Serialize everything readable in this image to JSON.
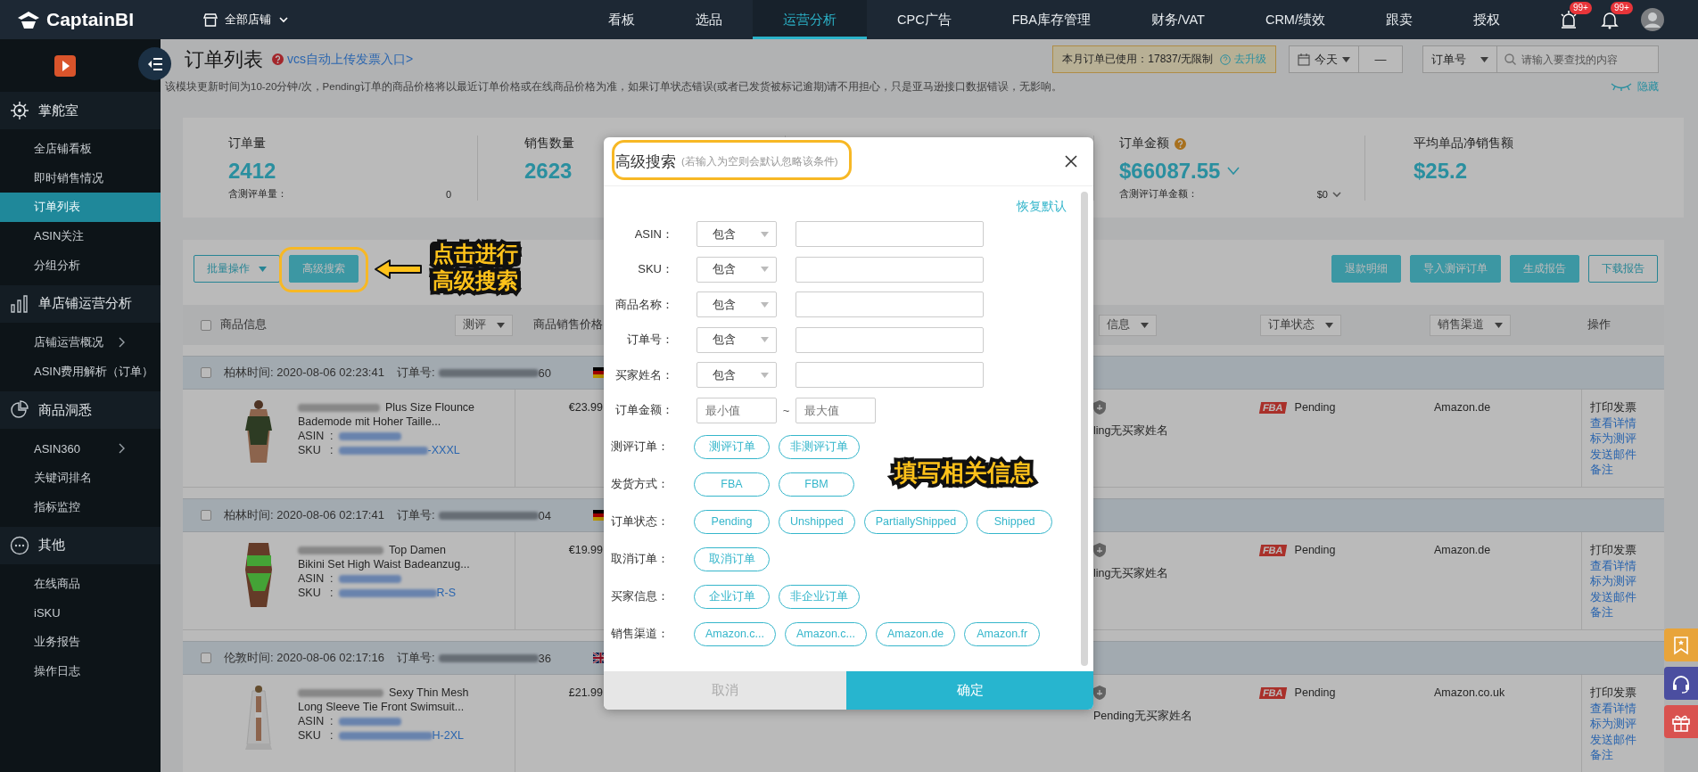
{
  "topbar": {
    "brand": "CaptainBI",
    "store": "全部店铺",
    "nav": [
      {
        "label": "看板",
        "selected": false
      },
      {
        "label": "选品",
        "selected": false
      },
      {
        "label": "运营分析",
        "selected": true
      },
      {
        "label": "CPC广告",
        "selected": false
      },
      {
        "label": "FBA库存管理",
        "selected": false
      },
      {
        "label": "财务/VAT",
        "selected": false
      },
      {
        "label": "CRM/绩效",
        "selected": false
      },
      {
        "label": "跟卖",
        "selected": false
      },
      {
        "label": "授权",
        "selected": false
      }
    ],
    "alerts": [
      {
        "kind": "alarm",
        "badge": "99+"
      },
      {
        "kind": "bell",
        "badge": "99+"
      }
    ]
  },
  "sidebar": {
    "sections": [
      {
        "title": "掌舵室",
        "items": [
          {
            "label": "全店铺看板",
            "selected": false,
            "expandable": false
          },
          {
            "label": "即时销售情况",
            "selected": false,
            "expandable": false
          },
          {
            "label": "订单列表",
            "selected": true,
            "expandable": false
          },
          {
            "label": "ASIN关注",
            "selected": false,
            "expandable": false
          },
          {
            "label": "分组分析",
            "selected": false,
            "expandable": false
          }
        ]
      },
      {
        "title": "单店铺运营分析",
        "items": [
          {
            "label": "店铺运营概况",
            "selected": false,
            "expandable": true
          },
          {
            "label": "ASIN费用解析（订单）",
            "selected": false,
            "expandable": false
          }
        ]
      },
      {
        "title": "商品洞悉",
        "items": [
          {
            "label": "ASIN360",
            "selected": false,
            "expandable": true
          },
          {
            "label": "关键词排名",
            "selected": false,
            "expandable": false
          },
          {
            "label": "指标监控",
            "selected": false,
            "expandable": false
          }
        ]
      },
      {
        "title": "其他",
        "items": [
          {
            "label": "在线商品",
            "selected": false,
            "expandable": false
          },
          {
            "label": "iSKU",
            "selected": false,
            "expandable": false
          },
          {
            "label": "业务报告",
            "selected": false,
            "expandable": false
          },
          {
            "label": "操作日志",
            "selected": false,
            "expandable": false
          }
        ]
      }
    ]
  },
  "header": {
    "title": "订单列表",
    "link": "vcs自动上传发票入口>",
    "quota": "本月订单已使用：17837/无限制",
    "upgrade": "去升级",
    "date": "今天",
    "dash": "—",
    "search_field": "订单号",
    "search_placeholder": "请输入要查找的内容",
    "note": "该模块更新时间为10-20分钟/次，Pending订单的商品价格将以最近订单价格或在线商品价格为准，如果订单状态错误(或者已发货被标记逾期)请不用担心，只是亚马逊接口数据错误，无影响。",
    "hide": "隐藏"
  },
  "stats": [
    {
      "label": "订单量",
      "value": "2412",
      "sub_label": "含测评单量：",
      "sub_value": "0",
      "help": false,
      "has_menu": false
    },
    {
      "label": "销售数量",
      "value": "2623",
      "help": false,
      "has_menu": false
    },
    {
      "label": "订单金额",
      "value": "$66087.55",
      "sub_label": "含测评订单金额：",
      "sub_value": "$0",
      "help": true,
      "has_menu": true
    },
    {
      "label": "平均单品净销售额",
      "value": "$25.2",
      "help": false,
      "has_menu": false
    }
  ],
  "toolbar": {
    "left": [
      {
        "label": "批量操作",
        "kind": "dropdown"
      },
      {
        "label": "高级搜索",
        "kind": "primary"
      }
    ],
    "right": [
      {
        "label": "退款明细",
        "kind": "primary"
      },
      {
        "label": "导入测评订单",
        "kind": "primary"
      },
      {
        "label": "生成报告",
        "kind": "primary"
      },
      {
        "label": "下载报告",
        "kind": "outline"
      }
    ]
  },
  "table": {
    "select_all_checked": false,
    "columns": [
      {
        "label": "商品信息",
        "kind": "text"
      },
      {
        "label": "测评",
        "kind": "filter"
      },
      {
        "label": "商品销售价格",
        "kind": "text"
      },
      {
        "label": "信息",
        "kind": "filter"
      },
      {
        "label": "订单状态",
        "kind": "filter"
      },
      {
        "label": "销售渠道",
        "kind": "filter"
      },
      {
        "label": "操作",
        "kind": "text"
      }
    ],
    "orders": [
      {
        "checked": false,
        "zone_time": "柏林时间: 2020-08-06 02:23:41",
        "order_label": "订单号:",
        "order_tail": "60",
        "kind": "de",
        "title_line1": "Plus Size Flounce",
        "title_line2": "Bademode mit Hoher Taille...",
        "asin_label": "ASIN  :",
        "sku_label": "SKU   :",
        "sku_tail": "-XXXL",
        "price": "€23.99",
        "buyer": "ling无买家姓名",
        "fulfillment": "FBA",
        "status": "Pending",
        "channel": "Amazon.de",
        "actions": [
          {
            "label": "打印发票",
            "kind": "plain"
          },
          {
            "label": "查看详情",
            "kind": "link"
          },
          {
            "label": "标为测评",
            "kind": "link"
          },
          {
            "label": "发送邮件",
            "kind": "link"
          },
          {
            "label": "备注",
            "kind": "link"
          }
        ]
      },
      {
        "checked": false,
        "zone_time": "柏林时间: 2020-08-06 02:17:41",
        "order_label": "订单号:",
        "order_tail": "04",
        "kind": "de",
        "title_line1": "Top Damen",
        "title_line2": "Bikini Set High Waist Badeanzug...",
        "asin_label": "ASIN  :",
        "sku_label": "SKU   :",
        "sku_tail": "R-S",
        "price": "€19.99",
        "buyer": "ling无买家姓名",
        "fulfillment": "FBA",
        "status": "Pending",
        "channel": "Amazon.de",
        "actions": [
          {
            "label": "打印发票",
            "kind": "plain"
          },
          {
            "label": "查看详情",
            "kind": "link"
          },
          {
            "label": "标为测评",
            "kind": "link"
          },
          {
            "label": "发送邮件",
            "kind": "link"
          },
          {
            "label": "备注",
            "kind": "link"
          }
        ]
      },
      {
        "checked": false,
        "zone_time": "伦敦时间: 2020-08-06 02:17:16",
        "order_label": "订单号:",
        "order_tail": "36",
        "kind": "uk",
        "title_line1": "Sexy Thin Mesh",
        "title_line2": "Long Sleeve Tie Front Swimsuit...",
        "asin_label": "ASIN  :",
        "sku_label": "SKU   :",
        "sku_tail": "H-2XL",
        "price": "£21.99",
        "buyer": "Pending无买家姓名",
        "fulfillment": "FBA",
        "status": "Pending",
        "channel": "Amazon.co.uk",
        "actions": [
          {
            "label": "打印发票",
            "kind": "plain"
          },
          {
            "label": "查看详情",
            "kind": "link"
          },
          {
            "label": "标为测评",
            "kind": "link"
          },
          {
            "label": "发送邮件",
            "kind": "link"
          },
          {
            "label": "备注",
            "kind": "link"
          }
        ]
      }
    ]
  },
  "modal": {
    "title": "高级搜索",
    "hint": "(若输入为空则会默认忽略该条件)",
    "reset": "恢复默认",
    "fields": [
      {
        "label": "ASIN：",
        "kind": "select",
        "option": "包含"
      },
      {
        "label": "SKU：",
        "kind": "select",
        "option": "包含"
      },
      {
        "label": "商品名称：",
        "kind": "select",
        "option": "包含"
      },
      {
        "label": "订单号：",
        "kind": "select",
        "option": "包含"
      },
      {
        "label": "买家姓名：",
        "kind": "select",
        "option": "包含"
      },
      {
        "label": "订单金额：",
        "kind": "range",
        "min_placeholder": "最小值",
        "separator": "~",
        "max_placeholder": "最大值"
      }
    ],
    "chip_groups": [
      {
        "label": "测评订单：",
        "chips": [
          {
            "label": "测评订单",
            "selected": false
          },
          {
            "label": "非测评订单",
            "selected": false
          }
        ]
      },
      {
        "label": "发货方式：",
        "chips": [
          {
            "label": "FBA",
            "selected": false
          },
          {
            "label": "FBM",
            "selected": false
          }
        ]
      },
      {
        "label": "订单状态：",
        "chips": [
          {
            "label": "Pending",
            "selected": false
          },
          {
            "label": "Unshipped",
            "selected": false
          },
          {
            "label": "PartiallyShipped",
            "selected": false
          },
          {
            "label": "Shipped",
            "selected": false
          }
        ]
      },
      {
        "label": "取消订单：",
        "chips": [
          {
            "label": "取消订单",
            "selected": false
          }
        ]
      },
      {
        "label": "买家信息：",
        "chips": [
          {
            "label": "企业订单",
            "selected": false
          },
          {
            "label": "非企业订单",
            "selected": false
          }
        ]
      },
      {
        "label": "销售渠道：",
        "chips": [
          {
            "label": "Amazon.c...",
            "selected": false
          },
          {
            "label": "Amazon.c...",
            "selected": false
          },
          {
            "label": "Amazon.de",
            "selected": false
          },
          {
            "label": "Amazon.fr",
            "selected": false
          }
        ]
      }
    ],
    "cancel": "取消",
    "confirm": "确定"
  },
  "annotations": {
    "click_hint": [
      "点击进行",
      "高级搜索"
    ],
    "fill_hint": "填写相关信息"
  },
  "float_buttons": [
    {
      "kind": "bookmark"
    },
    {
      "kind": "headset"
    },
    {
      "kind": "gift"
    }
  ]
}
